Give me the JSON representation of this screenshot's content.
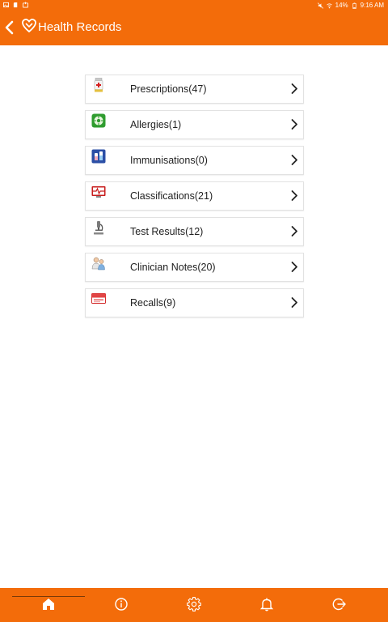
{
  "status_bar": {
    "battery": "14%",
    "time": "9:16 AM",
    "icons": [
      "gallery-icon",
      "sim-icon",
      "notification-icon",
      "mute-icon",
      "wifi-icon",
      "battery-icon"
    ]
  },
  "app_bar": {
    "title": "Health Records",
    "back_icon": "chevron-left-icon",
    "logo_icon": "heart-hand-icon"
  },
  "records": [
    {
      "label": "Prescriptions(47)",
      "icon": "prescription-bottle-icon"
    },
    {
      "label": "Allergies(1)",
      "icon": "allergy-icon"
    },
    {
      "label": "Immunisations(0)",
      "icon": "vaccine-icon"
    },
    {
      "label": "Classifications(21)",
      "icon": "heart-monitor-icon"
    },
    {
      "label": "Test Results(12)",
      "icon": "microscope-icon"
    },
    {
      "label": "Clinician Notes(20)",
      "icon": "doctor-icon"
    },
    {
      "label": "Recalls(9)",
      "icon": "recall-card-icon"
    }
  ],
  "bottom_nav": {
    "items": [
      "home-icon",
      "info-icon",
      "settings-icon",
      "bell-icon",
      "logout-icon"
    ],
    "active": "home-icon"
  },
  "colors": {
    "primary": "#f36c0a",
    "border": "#e2e2e2",
    "text": "#222222"
  }
}
